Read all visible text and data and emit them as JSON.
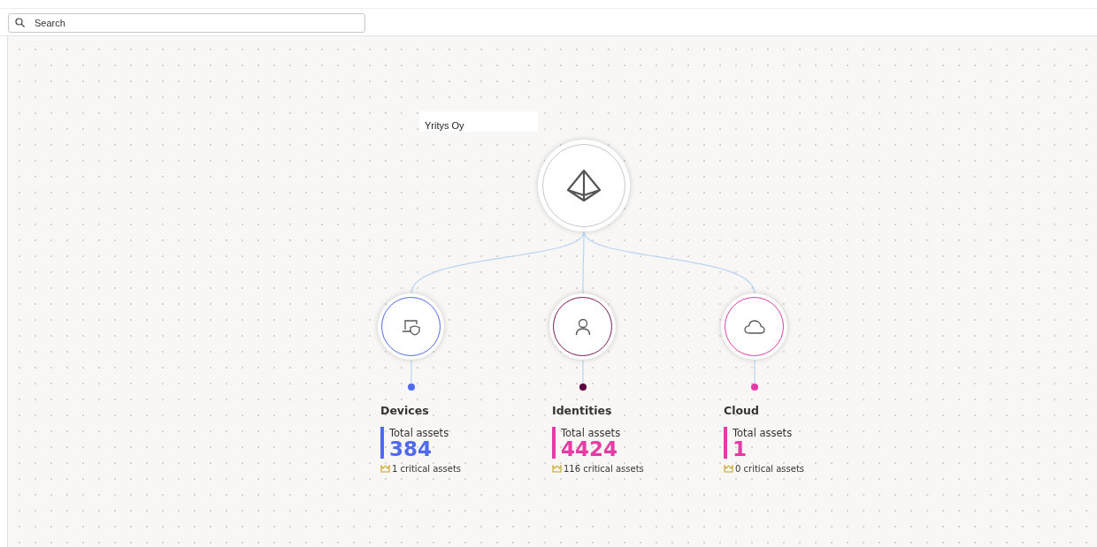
{
  "search": {
    "placeholder": "Search"
  },
  "root": {
    "label": "Yritys Oy"
  },
  "categories": [
    {
      "kind": "devices",
      "title": "Devices",
      "total_label": "Total assets",
      "total": "384",
      "critical": "1 critical assets",
      "color": "#4f6bed"
    },
    {
      "kind": "identities",
      "title": "Identities",
      "total_label": "Total assets",
      "total": "4424",
      "critical": "116 critical assets",
      "color": "#5c0040"
    },
    {
      "kind": "cloud",
      "title": "Cloud",
      "total_label": "Total assets",
      "total": "1",
      "critical": "0 critical assets",
      "color": "#e43ba6"
    }
  ]
}
